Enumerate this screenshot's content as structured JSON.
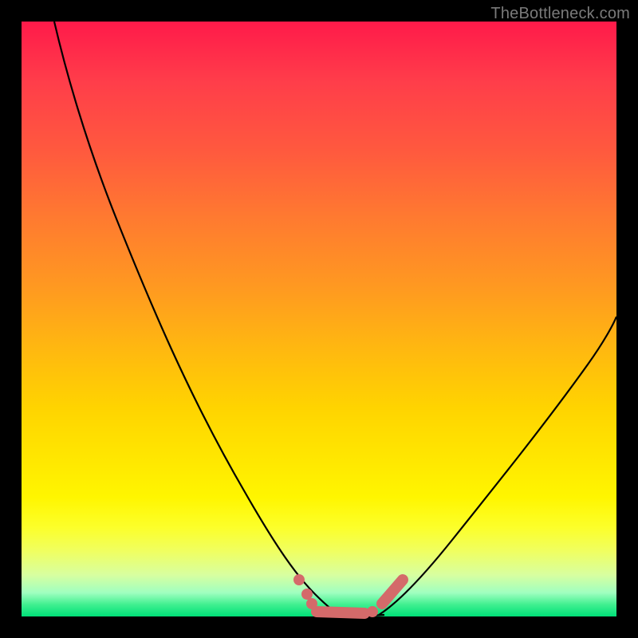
{
  "watermark": "TheBottleneck.com",
  "colors": {
    "background": "#000000",
    "curve": "#000000",
    "marker": "#d46a6a",
    "gradient_top": "#ff1a4a",
    "gradient_bottom": "#00e078"
  },
  "chart_data": {
    "type": "line",
    "title": "",
    "xlabel": "",
    "ylabel": "",
    "xlim": [
      0,
      100
    ],
    "ylim": [
      0,
      100
    ],
    "grid": false,
    "legend": false,
    "annotations": [
      "TheBottleneck.com"
    ],
    "series": [
      {
        "name": "left-branch",
        "x": [
          0,
          4,
          8,
          12,
          16,
          20,
          24,
          28,
          32,
          36,
          40,
          44,
          47,
          50,
          53
        ],
        "y": [
          100,
          93,
          86,
          79,
          71,
          63,
          55,
          47,
          40,
          32,
          24,
          16,
          9,
          3,
          0
        ]
      },
      {
        "name": "valley-floor",
        "x": [
          47,
          50,
          53,
          56,
          59,
          62
        ],
        "y": [
          1,
          0,
          0,
          0,
          0,
          1
        ]
      },
      {
        "name": "right-branch",
        "x": [
          60,
          64,
          68,
          72,
          76,
          80,
          84,
          88,
          92,
          96,
          100
        ],
        "y": [
          0,
          5,
          11,
          17,
          23,
          29,
          35,
          41,
          47,
          53,
          58
        ]
      }
    ],
    "markers": [
      {
        "x": 46,
        "y": 8
      },
      {
        "x": 48,
        "y": 4
      },
      {
        "x": 50,
        "y": 1
      },
      {
        "x": 53,
        "y": 0
      },
      {
        "x": 56,
        "y": 0
      },
      {
        "x": 58,
        "y": 0.5
      },
      {
        "x": 62,
        "y": 4
      },
      {
        "x": 64,
        "y": 7
      }
    ],
    "marker_segments": [
      {
        "x1": 49,
        "y1": 1,
        "x2": 57,
        "y2": 0
      },
      {
        "x1": 60,
        "y1": 2,
        "x2": 64,
        "y2": 7
      }
    ]
  }
}
